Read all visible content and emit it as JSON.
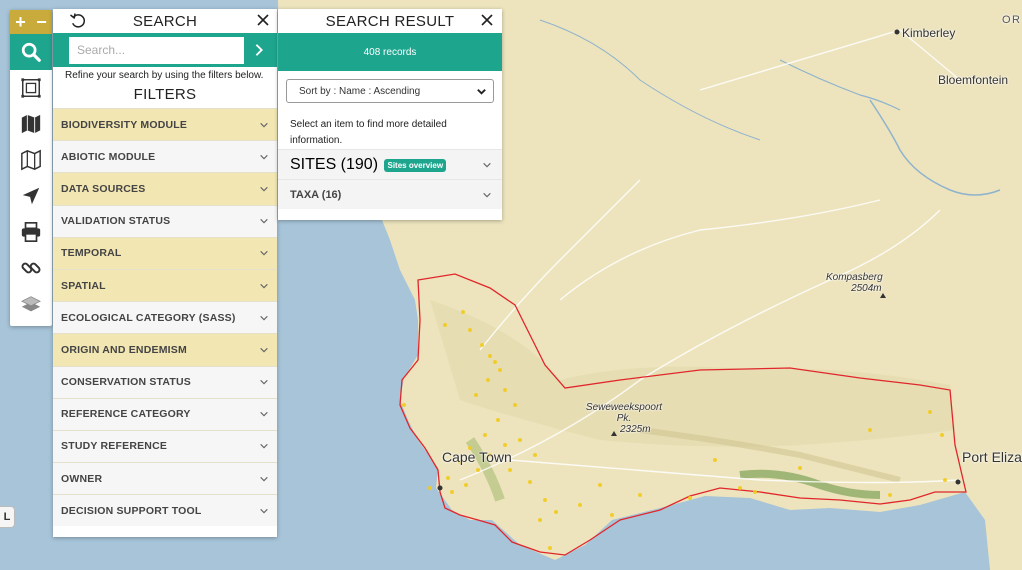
{
  "map": {
    "places": [
      {
        "name": "Kimberley"
      },
      {
        "name": "Bloemfontein"
      },
      {
        "name": "OR F ST"
      },
      {
        "name": "Cape Town"
      },
      {
        "name": "Port Elizabeth"
      }
    ],
    "peaks": [
      {
        "name": "Kompasberg",
        "elev": "2504m"
      },
      {
        "name": "Seweweekspoort Pk.",
        "elev": "2325m"
      }
    ],
    "colors": {
      "land": "#ede4bd",
      "water": "#a7c4d8",
      "boundary": "#e0262b",
      "sites": "#f2cb1d",
      "mountain": "#7fa35a"
    }
  },
  "toolbar": {
    "zoom_in": "+",
    "zoom_out": "−",
    "tools": [
      {
        "icon": "search-icon",
        "active": true
      },
      {
        "icon": "select-area-icon"
      },
      {
        "icon": "map-filled-icon"
      },
      {
        "icon": "map-outline-icon"
      },
      {
        "icon": "location-arrow-icon"
      },
      {
        "icon": "print-icon"
      },
      {
        "icon": "link-icon"
      },
      {
        "icon": "layers-icon"
      }
    ]
  },
  "search": {
    "title": "SEARCH",
    "placeholder": "Search...",
    "refine_text": "Refine your search by using the filters below.",
    "filters_title": "FILTERS",
    "filters": [
      {
        "label": "BIODIVERSITY MODULE",
        "highlighted": true
      },
      {
        "label": "ABIOTIC MODULE",
        "highlighted": false
      },
      {
        "label": "DATA SOURCES",
        "highlighted": true
      },
      {
        "label": "VALIDATION STATUS",
        "highlighted": false
      },
      {
        "label": "TEMPORAL",
        "highlighted": true
      },
      {
        "label": "SPATIAL",
        "highlighted": true
      },
      {
        "label": "ECOLOGICAL CATEGORY (SASS)",
        "highlighted": false
      },
      {
        "label": "ORIGIN AND ENDEMISM",
        "highlighted": true
      },
      {
        "label": "CONSERVATION STATUS",
        "highlighted": false
      },
      {
        "label": "REFERENCE CATEGORY",
        "highlighted": false
      },
      {
        "label": "STUDY REFERENCE",
        "highlighted": false
      },
      {
        "label": "OWNER",
        "highlighted": false
      },
      {
        "label": "DECISION SUPPORT TOOL",
        "highlighted": false
      }
    ]
  },
  "results": {
    "title": "SEARCH RESULT",
    "count": "408 records",
    "sort": "Sort by : Name : Ascending",
    "hint": "Select an item to find more detailed information.",
    "sites_label": "SITES (190)",
    "sites_badge": "Sites overview",
    "taxa_label": "TAXA (16)"
  },
  "left_tab": "L",
  "accent": "#1ea58e",
  "toolbar_zoom_color": "#c9ab3b"
}
